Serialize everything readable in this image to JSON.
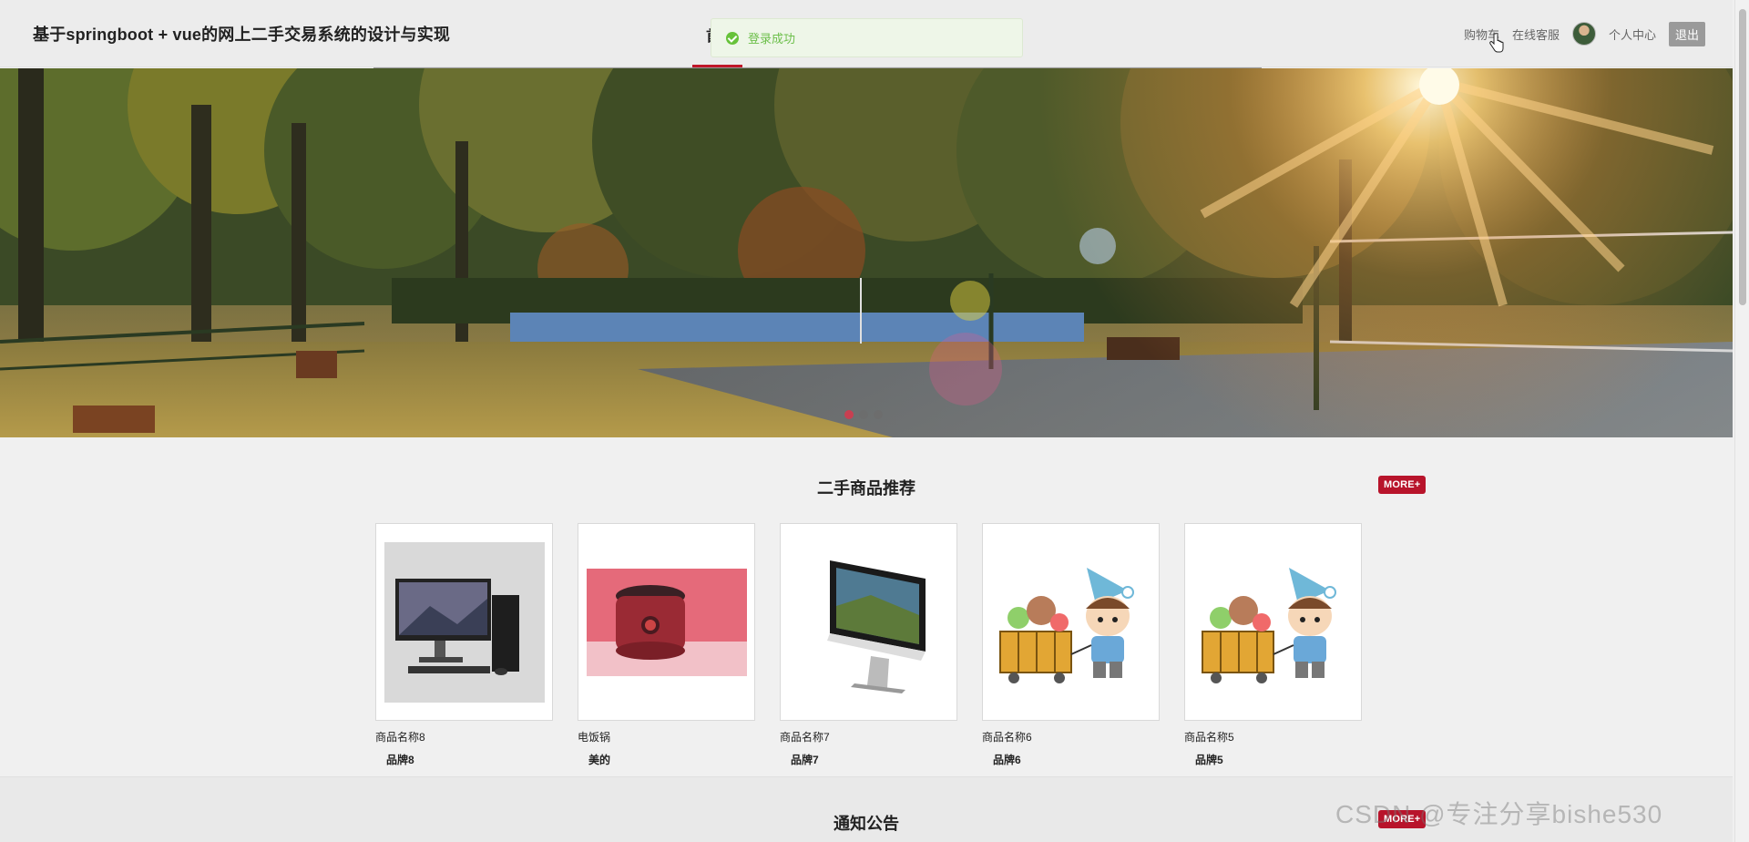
{
  "header": {
    "site_title": "基于springboot + vue的网上二手交易系统的设计与实现",
    "nav_partial": "首",
    "cart": "购物车",
    "service": "在线客服",
    "profile": "个人中心",
    "logout": "退出"
  },
  "toast": {
    "message": "登录成功"
  },
  "banner": {
    "active_slide": 1,
    "slide_count": 3
  },
  "recommend": {
    "title": "二手商品推荐",
    "more": "MORE+",
    "products": [
      {
        "name": "商品名称8",
        "brand": "品牌8",
        "image": "desktop-computer"
      },
      {
        "name": "电饭锅",
        "brand": "美的",
        "image": "rice-cooker"
      },
      {
        "name": "商品名称7",
        "brand": "品牌7",
        "image": "imac"
      },
      {
        "name": "商品名称6",
        "brand": "品牌6",
        "image": "boy-with-cart"
      },
      {
        "name": "商品名称5",
        "brand": "品牌5",
        "image": "boy-with-cart"
      }
    ]
  },
  "notice": {
    "title": "通知公告",
    "more": "MORE+"
  },
  "watermark": "CSDN @专注分享bishe530"
}
